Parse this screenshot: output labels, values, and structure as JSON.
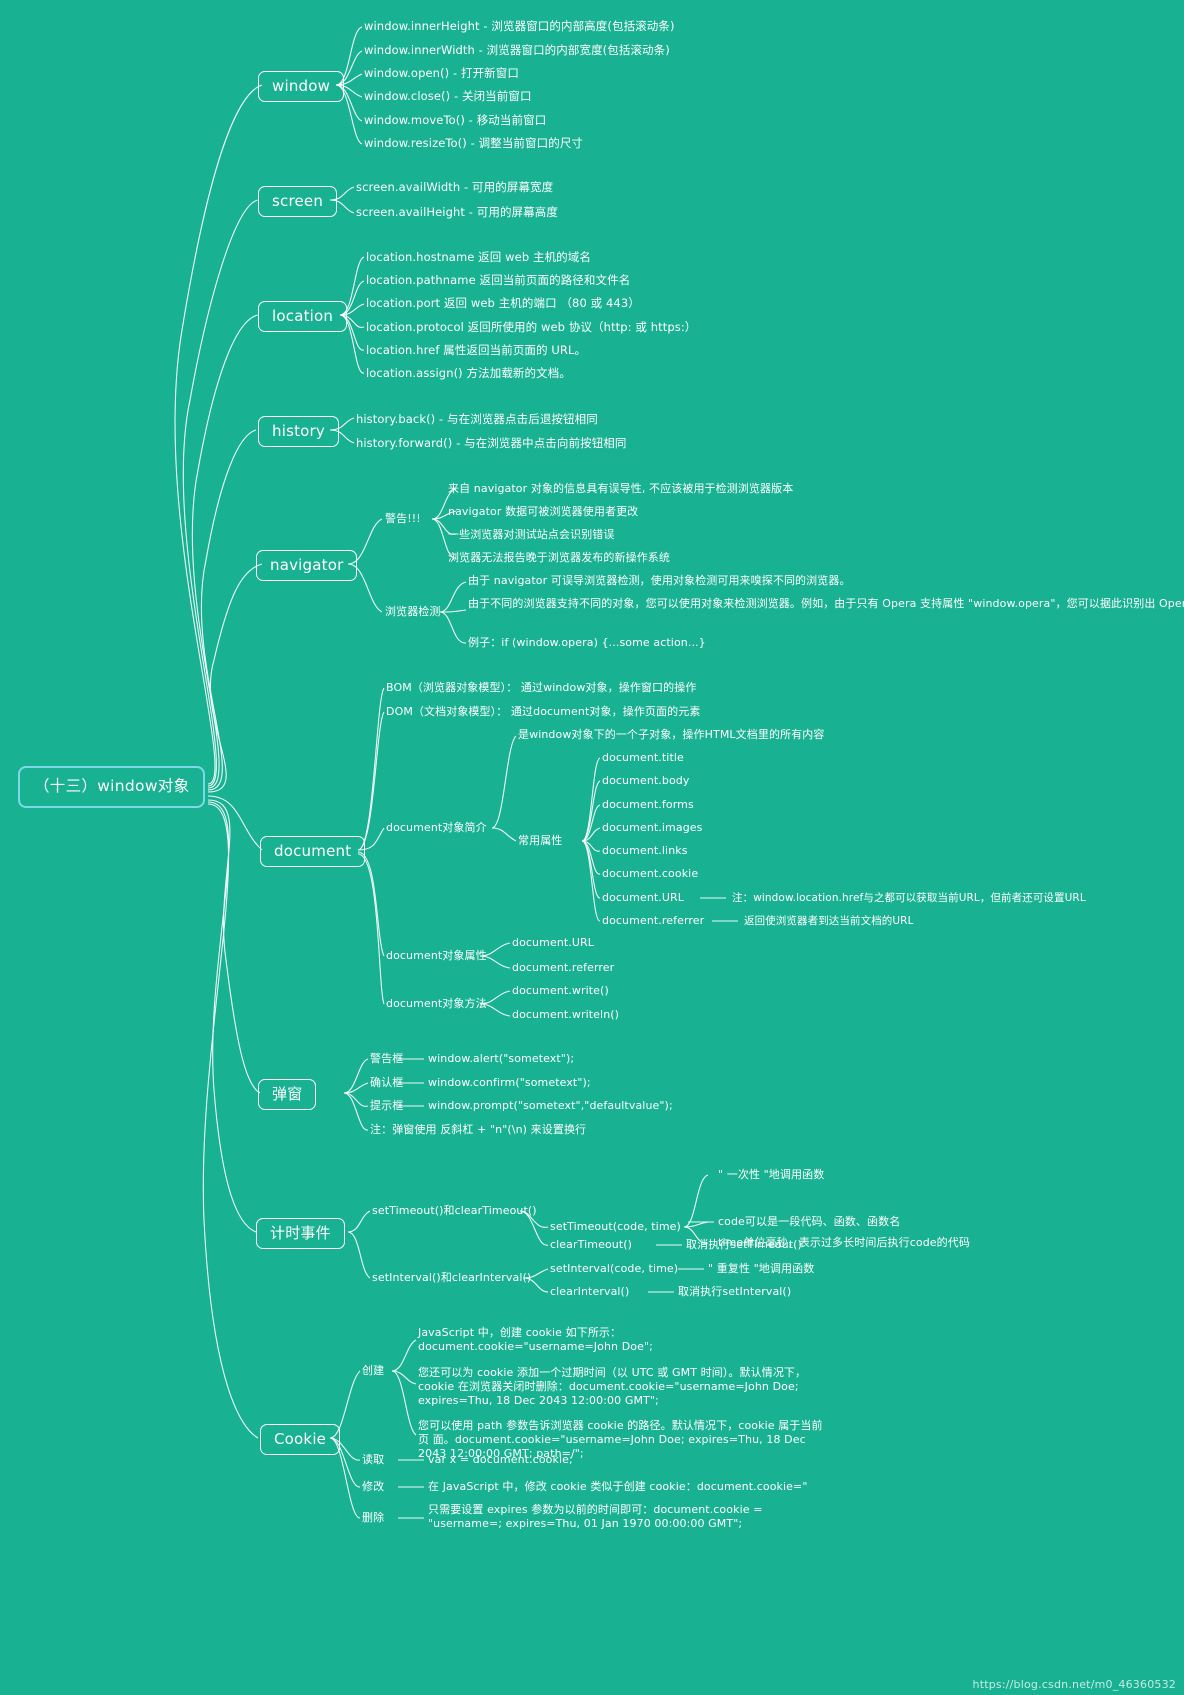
{
  "theme": {
    "background": "#18b192",
    "text": "#ffffff",
    "root_border": "#7fd8e8",
    "node_border": "#ffffff"
  },
  "root": {
    "label": "（十三）window对象"
  },
  "branches": {
    "window": {
      "label": "window",
      "children": [
        "window.innerHeight - 浏览器窗口的内部高度(包括滚动条)",
        "window.innerWidth - 浏览器窗口的内部宽度(包括滚动条)",
        "window.open() - 打开新窗口",
        "window.close() - 关闭当前窗口",
        "window.moveTo() - 移动当前窗口",
        "window.resizeTo() - 调整当前窗口的尺寸"
      ]
    },
    "screen": {
      "label": "screen",
      "children": [
        "screen.availWidth - 可用的屏幕宽度",
        "screen.availHeight - 可用的屏幕高度"
      ]
    },
    "location": {
      "label": "location",
      "children": [
        "location.hostname 返回 web 主机的域名",
        "location.pathname 返回当前页面的路径和文件名",
        "location.port 返回 web 主机的端口 （80 或 443）",
        "location.protocol 返回所使用的 web 协议（http: 或 https:）",
        "location.href 属性返回当前页面的 URL。",
        "location.assign() 方法加载新的文档。"
      ]
    },
    "history": {
      "label": "history",
      "children": [
        "history.back() - 与在浏览器点击后退按钮相同",
        "history.forward() - 与在浏览器中点击向前按钮相同"
      ]
    },
    "navigator": {
      "label": "navigator",
      "groups": [
        {
          "label": "警告!!!",
          "children": [
            "来自 navigator 对象的信息具有误导性, 不应该被用于检测浏览器版本",
            "navigator 数据可被浏览器使用者更改",
            "一些浏览器对测试站点会识别错误",
            "浏览器无法报告晚于浏览器发布的新操作系统"
          ]
        },
        {
          "label": "浏览器检测",
          "children": [
            "由于 navigator 可误导浏览器检测，使用对象检测可用来嗅探不同的浏览器。",
            "由于不同的浏览器支持不同的对象，您可以使用对象来检测浏览器。例如，由于只有\nOpera 支持属性 \"window.opera\"，您可以据此识别出 Opera。",
            "例子：if (window.opera) {...some action...}"
          ]
        }
      ]
    },
    "document": {
      "label": "document",
      "children": [
        "BOM（浏览器对象模型）： 通过window对象，操作窗口的操作",
        "DOM（文档对象模型）： 通过document对象，操作页面的元素"
      ],
      "intro": {
        "label": "document对象简介",
        "desc": "是window对象下的一个子对象，操作HTML文档里的所有内容",
        "props_label": "常用属性",
        "props": [
          {
            "name": "document.title",
            "note": ""
          },
          {
            "name": "document.body",
            "note": ""
          },
          {
            "name": "document.forms",
            "note": ""
          },
          {
            "name": "document.images",
            "note": ""
          },
          {
            "name": "document.links",
            "note": ""
          },
          {
            "name": "document.cookie",
            "note": ""
          },
          {
            "name": "document.URL",
            "note": "注：window.location.href与之都可以获取当前URL，但前者还可设置URL"
          },
          {
            "name": "document.referrer",
            "note": "返回使浏览器者到达当前文档的URL"
          }
        ]
      },
      "attrs": {
        "label": "document对象属性",
        "children": [
          "document.URL",
          "document.referrer"
        ]
      },
      "methods": {
        "label": "document对象方法",
        "children": [
          "document.write()",
          "document.writeln()"
        ]
      }
    },
    "dialog": {
      "label": "弹窗",
      "rows": [
        {
          "label": "警告框",
          "value": "window.alert(\"sometext\");"
        },
        {
          "label": "确认框",
          "value": "window.confirm(\"sometext\");"
        },
        {
          "label": "提示框",
          "value": "window.prompt(\"sometext\",\"defaultvalue\");"
        }
      ],
      "note": "注：弹窗使用 反斜杠 + \"n\"(\\n) 来设置换行"
    },
    "timer": {
      "label": "计时事件",
      "groups": [
        {
          "label": "setTimeout()和clearTimeout()",
          "rows": [
            {
              "label": "setTimeout(code, time)",
              "children": [
                "\" 一次性 \"地调用函数",
                "code可以是一段代码、函数、函数名",
                "time单位毫秒，表示过多长时间后执行code的代码"
              ]
            },
            {
              "label": "clearTimeout()",
              "value": "取消执行setTimeout()"
            }
          ]
        },
        {
          "label": "setInterval()和clearInterval()",
          "rows": [
            {
              "label": "setInterval(code, time)",
              "value": "\" 重复性 \"地调用函数"
            },
            {
              "label": "clearInterval()",
              "value": "取消执行setInterval()"
            }
          ]
        }
      ]
    },
    "cookie": {
      "label": "Cookie",
      "groups": [
        {
          "label": "创建",
          "children": [
            "JavaScript 中，创建 cookie 如下所示：document.cookie=\"username=John\nDoe\";",
            "您还可以为 cookie 添加一个过期时间（以 UTC 或 GMT 时间）。默认情况下，\ncookie 在浏览器关闭时删除：document.cookie=\"username=John Doe;\nexpires=Thu, 18 Dec 2043 12:00:00 GMT\";",
            "您可以使用 path 参数告诉浏览器 cookie 的路径。默认情况下，cookie 属于当前页\n面。document.cookie=\"username=John Doe; expires=Thu, 18 Dec 2043\n12:00:00 GMT; path=/\";"
          ]
        },
        {
          "label": "读取",
          "value": "var x = document.cookie;"
        },
        {
          "label": "修改",
          "value": "在 JavaScript 中，修改 cookie 类似于创建 cookie：document.cookie=\""
        },
        {
          "label": "删除",
          "value": "只需要设置 expires 参数为以前的时间即可：document.cookie = \"username=;\nexpires=Thu, 01 Jan 1970 00:00:00 GMT\";"
        }
      ]
    }
  },
  "watermark": "https://blog.csdn.net/m0_46360532"
}
